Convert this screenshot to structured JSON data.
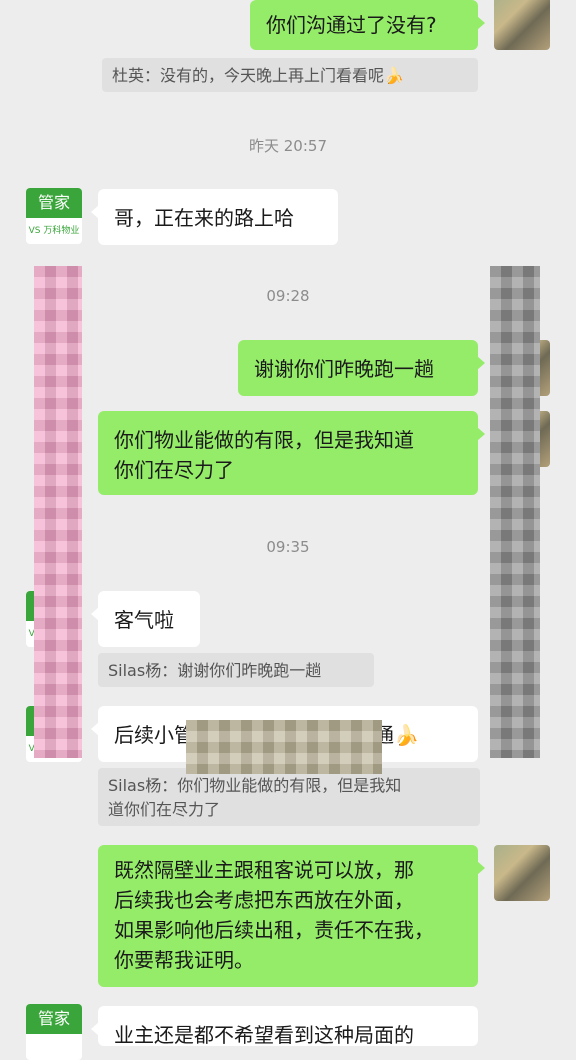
{
  "messages": {
    "m1_text": "你们沟通过了没有?",
    "q1_text": "杜英：没有的，今天晚上再上门看看呢🍌",
    "t1": "昨天 20:57",
    "m2_text": "哥，正在来的路上哈",
    "t2": "09:28",
    "m3_text": "谢谢你们昨晚跑一趟",
    "m4_line1": "你们物业能做的有限，但是我知道",
    "m4_line2": "你们在尽力了",
    "t3": "09:35",
    "m5_text": "客气啦",
    "q2_text": "Silas杨：谢谢你们昨晚跑一趟",
    "m6_text": "后续小管这边再和隔壁业主沟通🍌",
    "q3_line1": "Silas杨：你们物业能做的有限，但是我知",
    "q3_line2": "道你们在尽力了",
    "m7_line1": "既然隔壁业主跟租客说可以放，那",
    "m7_line2": "后续我也会考虑把东西放在外面，",
    "m7_line3": "如果影响他后续出租，责任不在我，",
    "m7_line4": "你要帮我证明。",
    "m8_text": "业主还是都不希望看到这种局面的"
  },
  "manager_avatar": {
    "label": "管家",
    "logo": "VS 万科物业"
  },
  "colors": {
    "background": "#ededed",
    "sent_bubble": "#95ec69",
    "received_bubble": "#ffffff",
    "manager_green": "#3aa53a"
  }
}
